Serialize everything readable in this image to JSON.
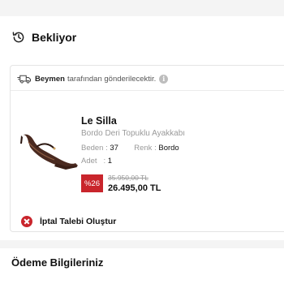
{
  "status": {
    "title": "Bekliyor",
    "icon": "history-clock-icon"
  },
  "shipping": {
    "brand": "Beymen",
    "text": "tarafından gönderilecektir.",
    "info_icon_glyph": "i"
  },
  "product": {
    "brand": "Le Silla",
    "name": "Bordo Deri Topuklu Ayakkabı",
    "size_label": "Beden :",
    "size_value": "37",
    "color_label": "Renk :",
    "color_value": "Bordo",
    "qty_label": "Adet   :",
    "qty_value": "1",
    "discount": "%26",
    "old_price": "35.950,00 TL",
    "new_price": "26.495,00 TL"
  },
  "cancel": {
    "label": "İptal Talebi Oluştur"
  },
  "payment": {
    "title": "Ödeme Bilgileriniz"
  },
  "colors": {
    "accent_red": "#c9252c",
    "background": "#f4f4f4",
    "card": "#ffffff"
  }
}
